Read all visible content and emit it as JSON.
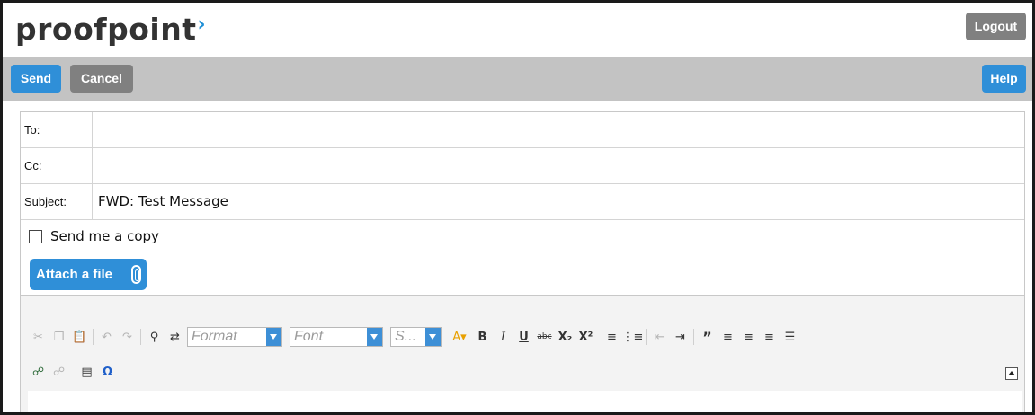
{
  "header": {
    "logo_text": "proofpoint",
    "logo_mark": "›",
    "logout_label": "Logout"
  },
  "toolbar": {
    "send_label": "Send",
    "cancel_label": "Cancel",
    "help_label": "Help"
  },
  "form": {
    "to_label": "To:",
    "to_value": "",
    "cc_label": "Cc:",
    "cc_value": "",
    "subject_label": "Subject:",
    "subject_value": "FWD: Test Message",
    "send_copy_label": "Send me a copy",
    "send_copy_checked": false,
    "attach_label": "Attach a file"
  },
  "editor": {
    "format_placeholder": "Format",
    "font_placeholder": "Font",
    "size_placeholder": "S...",
    "icons_row1": [
      "cut-icon",
      "copy-icon",
      "paste-icon",
      "undo-icon",
      "redo-icon",
      "find-icon",
      "replace-icon",
      "format-select",
      "font-select",
      "size-select",
      "text-color-icon",
      "bold-icon",
      "italic-icon",
      "underline-icon",
      "strikethrough-icon",
      "subscript-icon",
      "superscript-icon",
      "numbered-list-icon",
      "bullet-list-icon",
      "outdent-icon",
      "indent-icon",
      "blockquote-icon",
      "align-left-icon",
      "align-center-icon",
      "align-right-icon",
      "justify-icon"
    ],
    "icons_row2": [
      "link-icon",
      "unlink-icon",
      "horizontal-rule-icon",
      "special-char-icon"
    ],
    "glyphs": {
      "bold": "B",
      "italic": "I",
      "underline": "U",
      "strike": "abc",
      "sub": "X₂",
      "sup": "X²",
      "omega": "Ω",
      "quote": "”"
    }
  },
  "colors": {
    "brand_blue": "#2f8fd8",
    "gray_button": "#808080",
    "toolbar_bg": "#c3c3c3"
  }
}
